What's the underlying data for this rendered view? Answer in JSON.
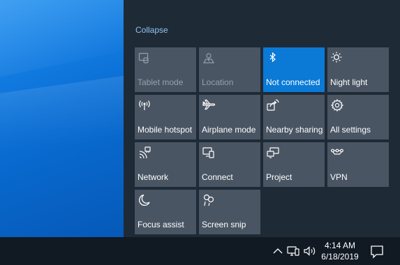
{
  "panel": {
    "collapse_label": "Collapse"
  },
  "tiles": [
    {
      "label": "Tablet mode",
      "icon": "tablet-mode-icon",
      "state": "disabled"
    },
    {
      "label": "Location",
      "icon": "location-icon",
      "state": "disabled"
    },
    {
      "label": "Not connected",
      "icon": "bluetooth-icon",
      "state": "active"
    },
    {
      "label": "Night light",
      "icon": "night-light-icon",
      "state": "off"
    },
    {
      "label": "Mobile hotspot",
      "icon": "mobile-hotspot-icon",
      "state": "off"
    },
    {
      "label": "Airplane mode",
      "icon": "airplane-icon",
      "state": "off"
    },
    {
      "label": "Nearby sharing",
      "icon": "nearby-sharing-icon",
      "state": "off"
    },
    {
      "label": "All settings",
      "icon": "gear-icon",
      "state": "off"
    },
    {
      "label": "Network",
      "icon": "network-icon",
      "state": "off"
    },
    {
      "label": "Connect",
      "icon": "connect-icon",
      "state": "off"
    },
    {
      "label": "Project",
      "icon": "project-icon",
      "state": "off"
    },
    {
      "label": "VPN",
      "icon": "vpn-icon",
      "state": "off"
    },
    {
      "label": "Focus assist",
      "icon": "focus-assist-icon",
      "state": "off"
    },
    {
      "label": "Screen snip",
      "icon": "screen-snip-icon",
      "state": "off"
    }
  ],
  "taskbar": {
    "time": "4:14 AM",
    "date": "6/18/2019"
  },
  "colors": {
    "accent": "#0a7ad6",
    "tile": "#4a5563",
    "panel": "#1f2a37",
    "taskbar": "#111a23",
    "collapse_link": "#8fc4ee"
  }
}
